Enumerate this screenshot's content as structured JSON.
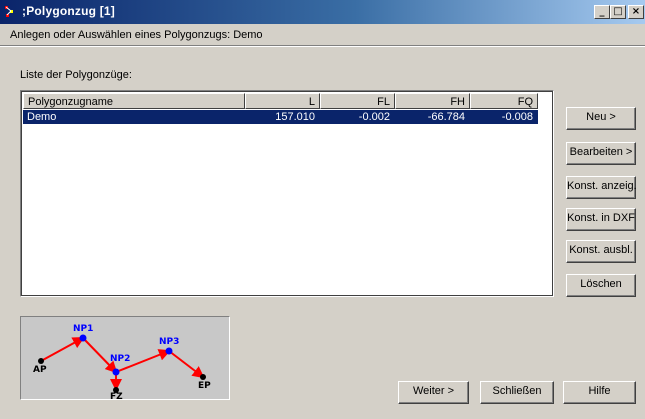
{
  "window": {
    "title": ";Polygonzug [1]",
    "subtitle": "Anlegen oder Auswählen eines Polygonzugs: Demo",
    "controls": {
      "minimize": "_",
      "maximize": "□",
      "close": "×"
    }
  },
  "list": {
    "label": "Liste der Polygonzüge:",
    "columns": [
      "Polygonzugname",
      "L",
      "FL",
      "FH",
      "FQ"
    ],
    "rows": [
      {
        "name": "Demo",
        "L": "157.010",
        "FL": "-0.002",
        "FH": "-66.784",
        "FQ": "-0.008",
        "selected": true
      }
    ]
  },
  "side_buttons": {
    "neu": "Neu >",
    "bearbeiten": "Bearbeiten >",
    "konst_anzeig": "Konst. anzeig.",
    "konst_dxf": "Konst. in DXF",
    "konst_ausbl": "Konst. ausbl.",
    "loeschen": "Löschen"
  },
  "bottom_buttons": {
    "weiter": "Weiter >",
    "schliessen": "Schließen",
    "hilfe": "Hilfe"
  },
  "preview": {
    "points": {
      "ap": "AP",
      "np1": "NP1",
      "np2": "NP2",
      "np3": "NP3",
      "ep": "EP",
      "fz": "FZ"
    },
    "colors": {
      "line": "#ff0000",
      "node": "#0000ff",
      "label_blue": "#0000ff",
      "label_black": "#000000"
    }
  }
}
